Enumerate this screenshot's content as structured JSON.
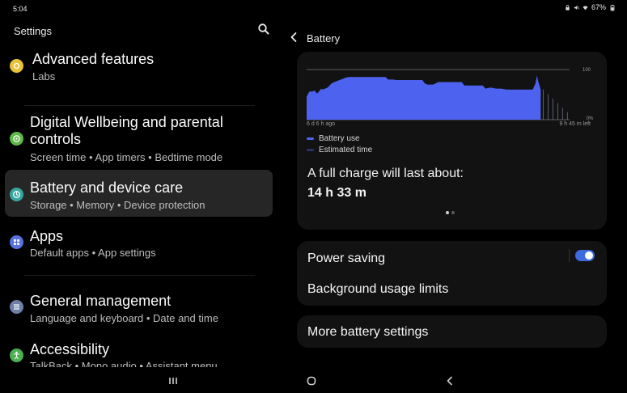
{
  "status_bar": {
    "time": "5:04",
    "battery_percent": "67%",
    "icons": [
      "lock-icon",
      "mute-icon",
      "wifi-icon",
      "battery-icon"
    ]
  },
  "left_pane": {
    "title": "Settings",
    "search_icon": "search-icon",
    "items": [
      {
        "title": "Advanced features",
        "subtitle": "Labs",
        "icon": "advanced-features-icon",
        "icon_color": "#e8c33a"
      },
      {
        "title": "Digital Wellbeing and parental controls",
        "subtitle": "Screen time  •  App timers  •  Bedtime mode",
        "icon": "digital-wellbeing-icon",
        "icon_color": "#5fb84a"
      },
      {
        "title": "Battery and device care",
        "subtitle": "Storage  •  Memory  •  Device protection",
        "icon": "device-care-icon",
        "icon_color": "#35a7a0",
        "selected": true
      },
      {
        "title": "Apps",
        "subtitle": "Default apps  •  App settings",
        "icon": "apps-icon",
        "icon_color": "#5872e0"
      },
      {
        "title": "General management",
        "subtitle": "Language and keyboard  •  Date and time",
        "icon": "general-management-icon",
        "icon_color": "#6f7fa8"
      },
      {
        "title": "Accessibility",
        "subtitle": "TalkBack  •  Mono audio  •  Assistant menu",
        "icon": "accessibility-icon",
        "icon_color": "#4caf50"
      }
    ]
  },
  "right_pane": {
    "title": "Battery",
    "back_icon": "back-arrow-icon",
    "usage_card": {
      "axis_left_label": "6 d 6 h ago",
      "axis_right_label": "9 h 45 m left",
      "y_max_label": "100",
      "y_min_label": "0%",
      "legend": [
        {
          "label": "Battery use",
          "color": "#4d63f0"
        },
        {
          "label": "Estimated time",
          "color": "#2a3166"
        }
      ],
      "full_charge_label": "A full charge will last about:",
      "full_charge_value": "14 h 33 m",
      "page_indicator": {
        "pages": 2,
        "active": 1
      }
    },
    "power_saving": {
      "label": "Power saving",
      "enabled": true,
      "accent": "#3e6ae0"
    },
    "background_limits": {
      "label": "Background usage limits"
    },
    "more_settings": {
      "label": "More battery settings"
    }
  },
  "nav_bar": {
    "buttons": [
      {
        "name": "recents",
        "icon": "recents-icon"
      },
      {
        "name": "home",
        "icon": "home-icon"
      },
      {
        "name": "back",
        "icon": "back-icon"
      }
    ]
  },
  "chart_data": {
    "type": "area",
    "title": "",
    "xlabel": "",
    "ylabel": "",
    "x_start_label": "6 d 6 h ago",
    "x_end_label": "9 h 45 m left",
    "ylim": [
      0,
      100
    ],
    "y_ticks": [
      "100",
      "0%"
    ],
    "series": [
      {
        "name": "Battery use",
        "color": "#4d63f0",
        "points": [
          [
            0,
            46
          ],
          [
            1,
            56
          ],
          [
            2,
            56
          ],
          [
            3,
            58
          ],
          [
            4,
            52
          ],
          [
            5,
            58
          ],
          [
            5.5,
            62
          ],
          [
            6,
            60
          ],
          [
            7,
            62
          ],
          [
            8,
            64
          ],
          [
            9,
            70
          ],
          [
            10,
            74
          ],
          [
            11,
            76
          ],
          [
            12,
            78
          ],
          [
            13,
            80
          ],
          [
            14,
            82
          ],
          [
            15,
            84
          ],
          [
            16,
            85
          ],
          [
            30,
            85
          ],
          [
            31,
            80
          ],
          [
            32,
            80
          ],
          [
            33,
            80
          ],
          [
            34,
            79
          ],
          [
            44,
            79
          ],
          [
            45,
            72
          ],
          [
            46,
            70
          ],
          [
            47,
            70
          ],
          [
            48,
            70
          ],
          [
            49,
            72
          ],
          [
            50,
            75
          ],
          [
            59,
            75
          ],
          [
            60,
            68
          ],
          [
            61,
            68
          ],
          [
            67,
            68
          ],
          [
            68,
            62
          ],
          [
            70,
            64
          ],
          [
            72,
            62
          ],
          [
            74,
            62
          ],
          [
            76,
            60
          ],
          [
            86,
            60
          ],
          [
            87,
            72
          ],
          [
            87.6,
            88
          ],
          [
            88,
            78
          ],
          [
            89,
            60
          ]
        ]
      }
    ],
    "estimated_range": [
      89,
      100
    ],
    "grid": true
  }
}
